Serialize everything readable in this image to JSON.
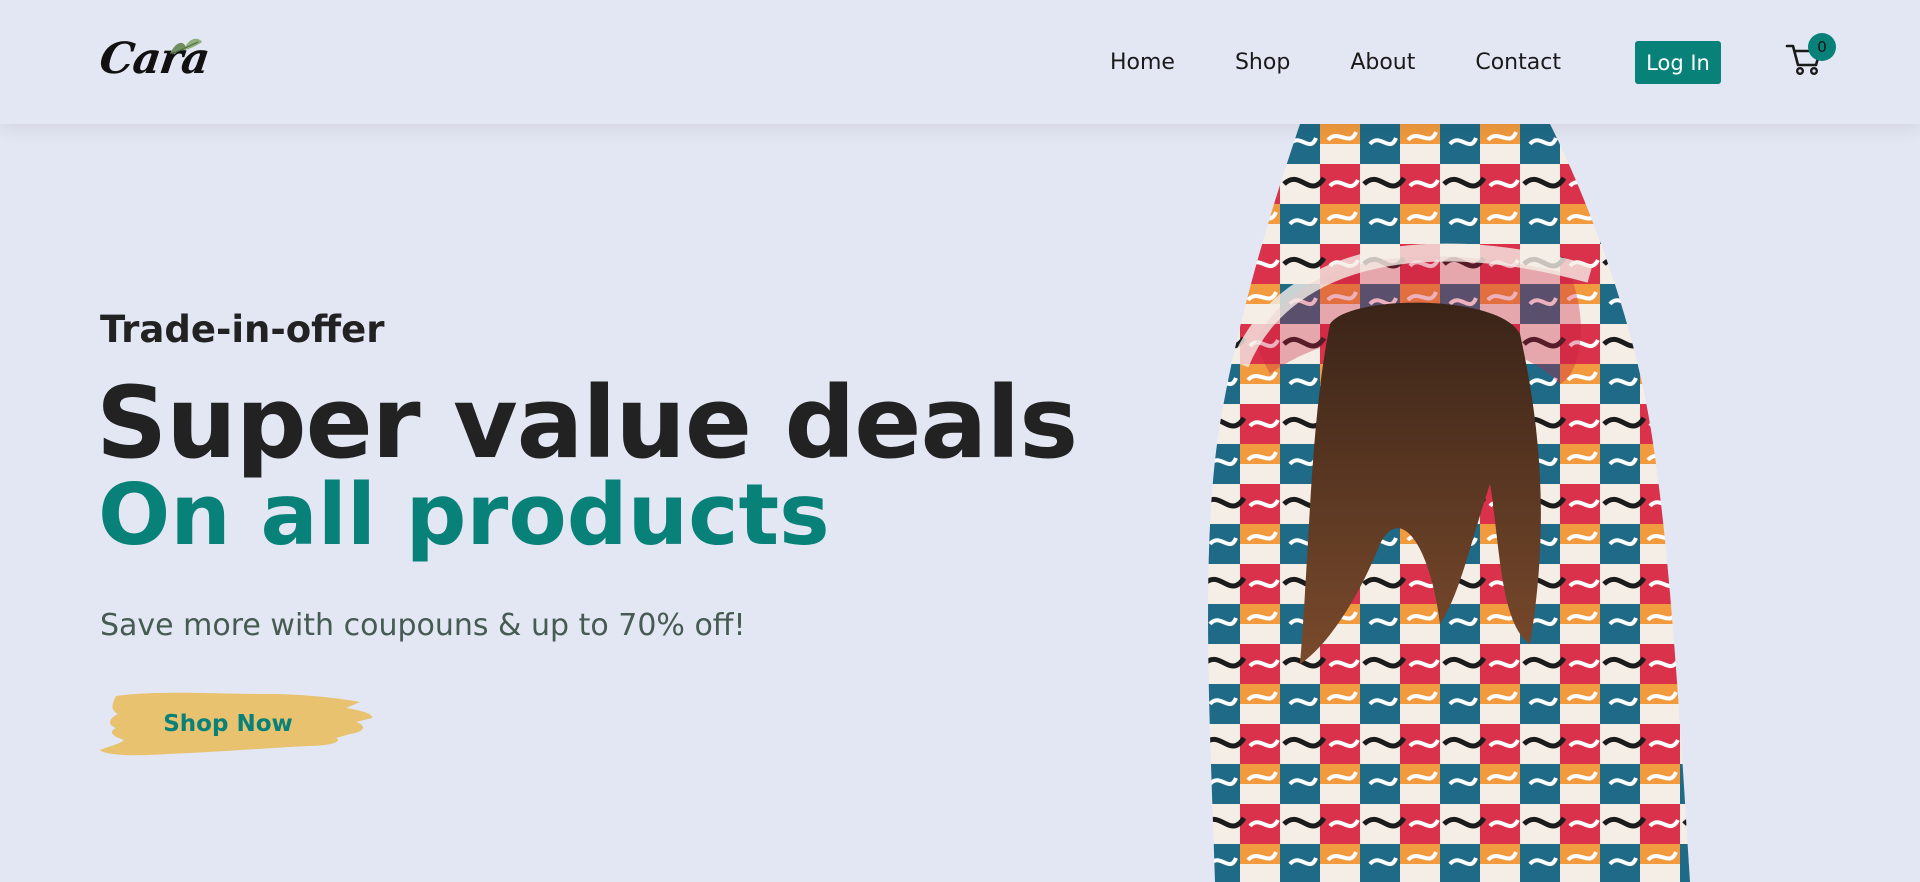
{
  "brand": {
    "name": "Cara"
  },
  "nav": {
    "links": [
      "Home",
      "Shop",
      "About",
      "Contact"
    ],
    "login_label": "Log In",
    "cart_count": "0"
  },
  "hero": {
    "eyebrow": "Trade-in-offer",
    "title": "Super value deals",
    "subtitle": "On all products",
    "text": "Save more with coupouns & up to 70% off!",
    "cta_label": "Shop Now"
  },
  "colors": {
    "background": "#e3e6f3",
    "accent": "#088178",
    "cta_brush": "#e8c26f",
    "heading": "#222222"
  },
  "icons": [
    "leaf-icon",
    "cart-icon"
  ]
}
